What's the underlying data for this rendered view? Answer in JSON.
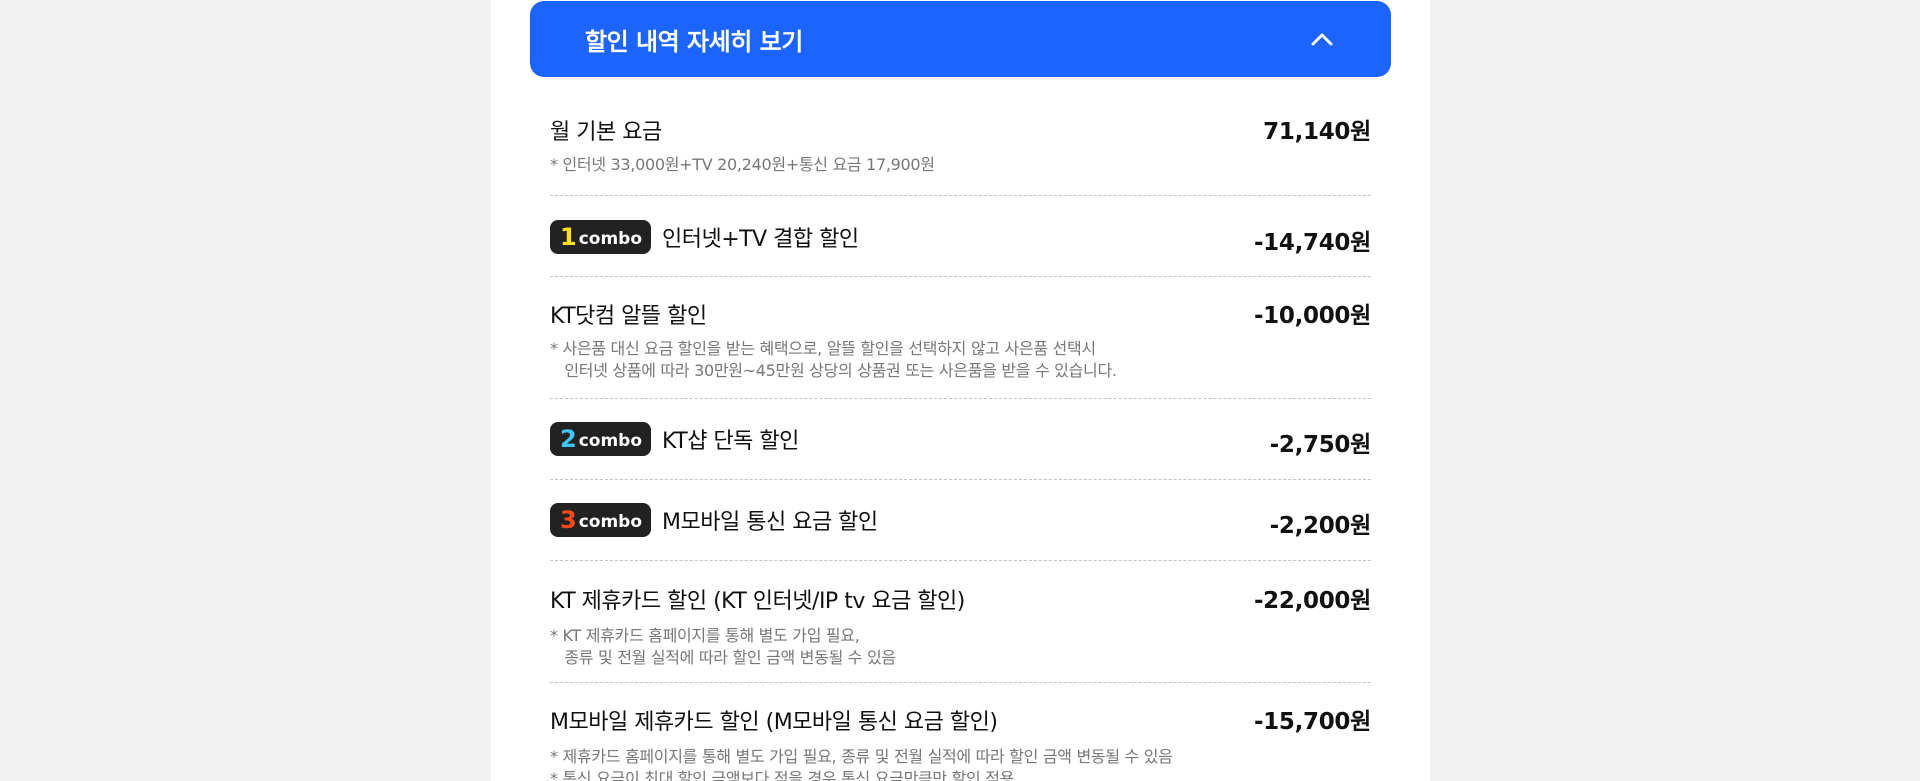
{
  "header": {
    "title": "할인 내역 자세히 보기"
  },
  "colors": {
    "accent": "#1b64ff",
    "badge_bg": "#222222",
    "combo1": "#ffe01b",
    "combo2": "#3fc5ff",
    "combo3": "#ff4a17"
  },
  "rows": [
    {
      "title": "월 기본 요금",
      "amount": "71,140원",
      "note": "* 인터넷 33,000원+TV 20,240원+통신 요금 17,900원"
    },
    {
      "badge_num": "1",
      "badge_word": "combo",
      "title": "인터넷+TV 결합 할인",
      "amount": "-14,740원"
    },
    {
      "title": "KT닷컴 알뜰 할인",
      "amount": "-10,000원",
      "note": "* 사은품 대신 요금 할인을 받는 혜택으로, 알뜰 할인을 선택하지 않고 사은품 선택시\n   인터넷 상품에 따라 30만원~45만원 상당의 상품권 또는 사은품을 받을 수 있습니다."
    },
    {
      "badge_num": "2",
      "badge_word": "combo",
      "title": "KT샵 단독 할인",
      "amount": "-2,750원"
    },
    {
      "badge_num": "3",
      "badge_word": "combo",
      "title": "M모바일 통신 요금 할인",
      "amount": "-2,200원"
    },
    {
      "title": "KT 제휴카드 할인 (KT 인터넷/IP tv 요금 할인)",
      "amount": "-22,000원",
      "note": "* KT 제휴카드 홈페이지를 통해 별도 가입 필요,\n   종류 및 전월 실적에 따라 할인 금액 변동될 수 있음"
    },
    {
      "title": "M모바일 제휴카드 할인 (M모바일 통신 요금 할인)",
      "amount": "-15,700원",
      "note": "* 제휴카드 홈페이지를 통해 별도 가입 필요, 종류 및 전월 실적에 따라 할인 금액 변동될 수 있음\n* 통신 요금이 최대 할인 금액보다 적을 경우 통신 요금만큼만 할인 적용"
    }
  ]
}
